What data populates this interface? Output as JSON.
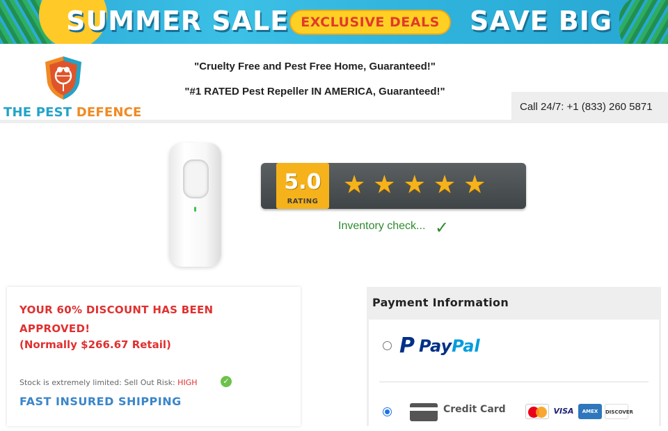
{
  "banner": {
    "left_text": "SUMMER SALE",
    "pill_text": "EXCLUSIVE DEALS",
    "right_text": "SAVE BIG"
  },
  "header": {
    "logo": {
      "the": "THE ",
      "pest": "PEST ",
      "defence": "DEFENCE"
    },
    "tagline_1": "\"Cruelty Free and Pest Free Home, Guaranteed!\"",
    "tagline_2": "\"#1 RATED Pest Repeller IN AMERICA, Guaranteed!\"",
    "call_label": "Call 24/7: +1 (833) 260 5871"
  },
  "rating": {
    "value": "5.0",
    "label": "RATING",
    "stars": 5
  },
  "inventory": {
    "text": "Inventory check..."
  },
  "discount": {
    "title": "YOUR 60% DISCOUNT HAS BEEN APPROVED!",
    "retail": "(Normally $266.67 Retail)",
    "stock_text": "Stock is extremely limited: Sell Out Risk: ",
    "stock_risk": "HIGH",
    "shipping": "FAST INSURED SHIPPING"
  },
  "payment": {
    "header": "Payment Information",
    "options": [
      {
        "id": "paypal",
        "label_pay": "Pay",
        "label_pal": "Pal",
        "selected": false
      },
      {
        "id": "credit-card",
        "label": "Credit Card",
        "selected": true
      }
    ],
    "card_brands": [
      "mastercard-icon",
      "visa-icon",
      "amex-icon",
      "discover-icon"
    ],
    "visa_text": "VISA",
    "amex_text": "AMEX",
    "discover_text": "DISCOVER"
  },
  "colors": {
    "accent_red": "#e03030",
    "accent_blue": "#3a85c9",
    "success_green": "#2f8a2f",
    "star_gold": "#f6b21b",
    "paypal_dark": "#003087",
    "paypal_light": "#009cde"
  }
}
